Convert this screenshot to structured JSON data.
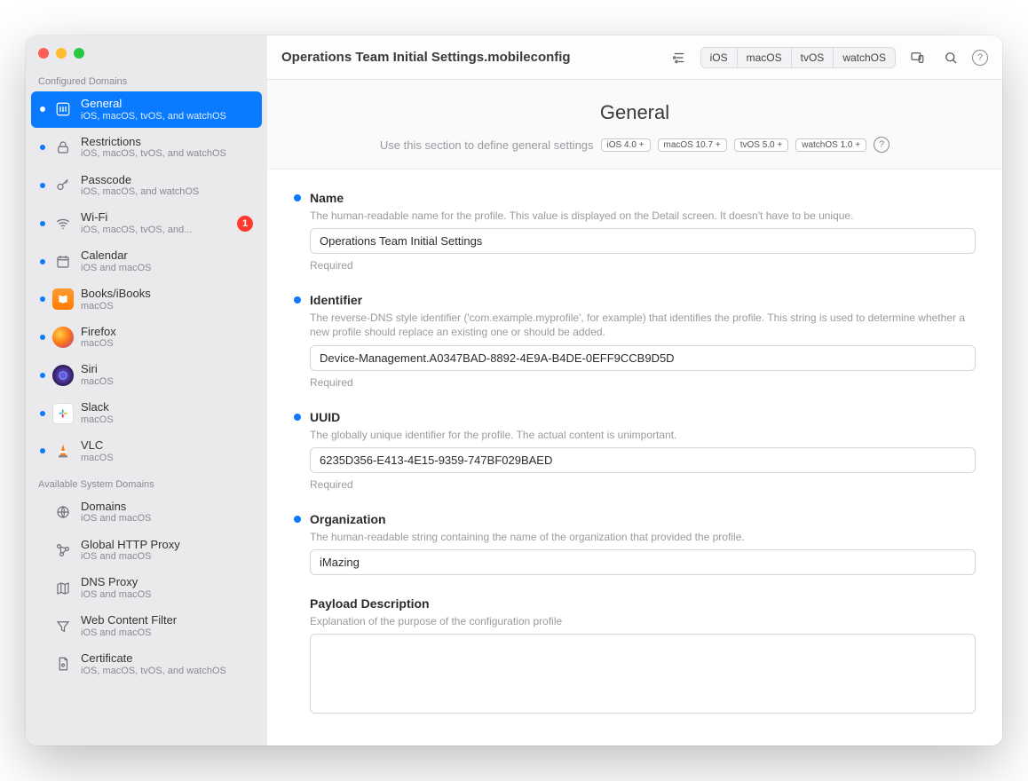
{
  "window": {
    "title": "Operations Team Initial Settings.mobileconfig"
  },
  "toolbar": {
    "os_tabs": [
      "iOS",
      "macOS",
      "tvOS",
      "watchOS"
    ]
  },
  "sidebar": {
    "configured_header": "Configured Domains",
    "available_header": "Available System Domains",
    "configured": [
      {
        "title": "General",
        "sub": "iOS, macOS, tvOS, and watchOS"
      },
      {
        "title": "Restrictions",
        "sub": "iOS, macOS, tvOS, and watchOS"
      },
      {
        "title": "Passcode",
        "sub": "iOS, macOS, and watchOS"
      },
      {
        "title": "Wi-Fi",
        "sub": "iOS, macOS, tvOS, and...",
        "badge": "1"
      },
      {
        "title": "Calendar",
        "sub": "iOS and macOS"
      },
      {
        "title": "Books/iBooks",
        "sub": "macOS"
      },
      {
        "title": "Firefox",
        "sub": "macOS"
      },
      {
        "title": "Siri",
        "sub": "macOS"
      },
      {
        "title": "Slack",
        "sub": "macOS"
      },
      {
        "title": "VLC",
        "sub": "macOS"
      }
    ],
    "available": [
      {
        "title": "Domains",
        "sub": "iOS and macOS"
      },
      {
        "title": "Global HTTP Proxy",
        "sub": "iOS and macOS"
      },
      {
        "title": "DNS Proxy",
        "sub": "iOS and macOS"
      },
      {
        "title": "Web Content Filter",
        "sub": "iOS and macOS"
      },
      {
        "title": "Certificate",
        "sub": "iOS, macOS, tvOS, and watchOS"
      }
    ]
  },
  "page": {
    "title": "General",
    "subtitle": "Use this section to define general settings",
    "pills": [
      "iOS  4.0 +",
      "macOS  10.7 +",
      "tvOS  5.0 +",
      "watchOS  1.0 +"
    ]
  },
  "fields": {
    "name": {
      "label": "Name",
      "desc": "The human-readable name for the profile. This value is displayed on the Detail screen. It doesn't have to be unique.",
      "value": "Operations Team Initial Settings",
      "required": "Required"
    },
    "identifier": {
      "label": "Identifier",
      "desc": "The reverse-DNS style identifier ('com.example.myprofile', for example) that identifies the profile. This string is used to determine whether a new profile should replace an existing one or should be added.",
      "value": "Device-Management.A0347BAD-8892-4E9A-B4DE-0EFF9CCB9D5D",
      "required": "Required"
    },
    "uuid": {
      "label": "UUID",
      "desc": "The globally unique identifier for the profile. The actual content is unimportant.",
      "value": "6235D356-E413-4E15-9359-747BF029BAED",
      "required": "Required"
    },
    "organization": {
      "label": "Organization",
      "desc": "The human-readable string containing the name of the organization that provided the profile.",
      "value": "iMazing"
    },
    "payload": {
      "label": "Payload Description",
      "desc": "Explanation of the purpose of the configuration profile",
      "value": ""
    }
  }
}
